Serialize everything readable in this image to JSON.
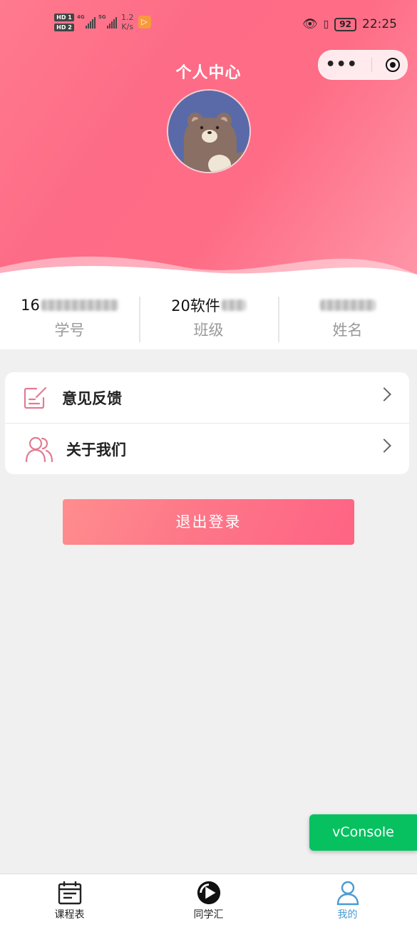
{
  "status_bar": {
    "hd1": "HD 1",
    "hd2": "HD 2",
    "net1": "4G",
    "net2": "5G",
    "speed_value": "1.2",
    "speed_unit": "K/s",
    "battery": "92",
    "time": "22:25"
  },
  "header": {
    "title": "个人中心"
  },
  "profile": {
    "student_id_value": "16",
    "student_id_label": "学号",
    "class_value": "20软件",
    "class_label": "班级",
    "name_label": "姓名"
  },
  "menu": {
    "items": [
      {
        "label": "意见反馈",
        "icon": "edit-icon"
      },
      {
        "label": "关于我们",
        "icon": "users-icon"
      }
    ]
  },
  "logout_label": "退出登录",
  "vconsole_label": "vConsole",
  "tabbar": {
    "items": [
      {
        "label": "课程表",
        "icon": "calendar-icon",
        "active": false
      },
      {
        "label": "同学汇",
        "icon": "play-circle-icon",
        "active": false
      },
      {
        "label": "我的",
        "icon": "user-icon",
        "active": true
      }
    ]
  },
  "colors": {
    "accent": "#fe6c85",
    "tab_active": "#4a9bd3",
    "vconsole": "#07c160"
  }
}
